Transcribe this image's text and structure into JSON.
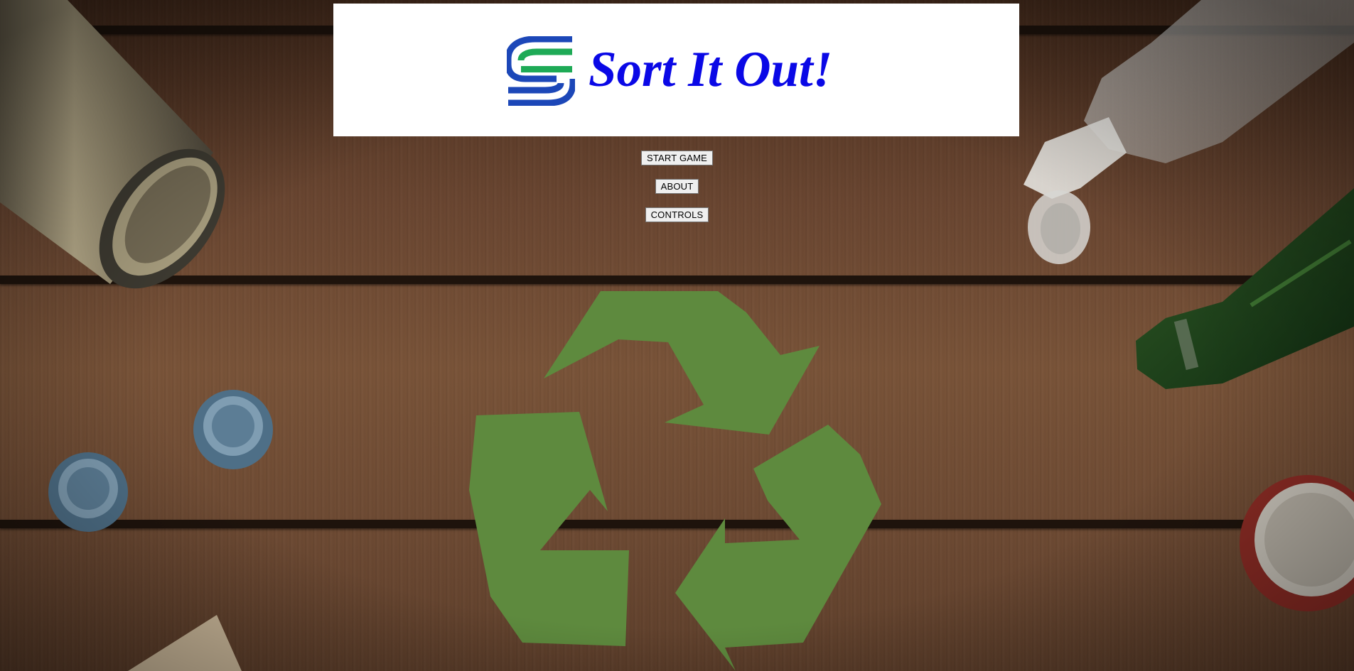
{
  "header": {
    "title": "Sort It Out!",
    "logo_icon": "s-stripes-logo-icon",
    "title_color": "#0a08e6"
  },
  "menu": {
    "start_label": "START GAME",
    "about_label": "ABOUT",
    "controls_label": "CONTROLS"
  },
  "background": {
    "description_icon": "recycling-symbol-icon",
    "recycle_color": "#5e8a3e"
  }
}
